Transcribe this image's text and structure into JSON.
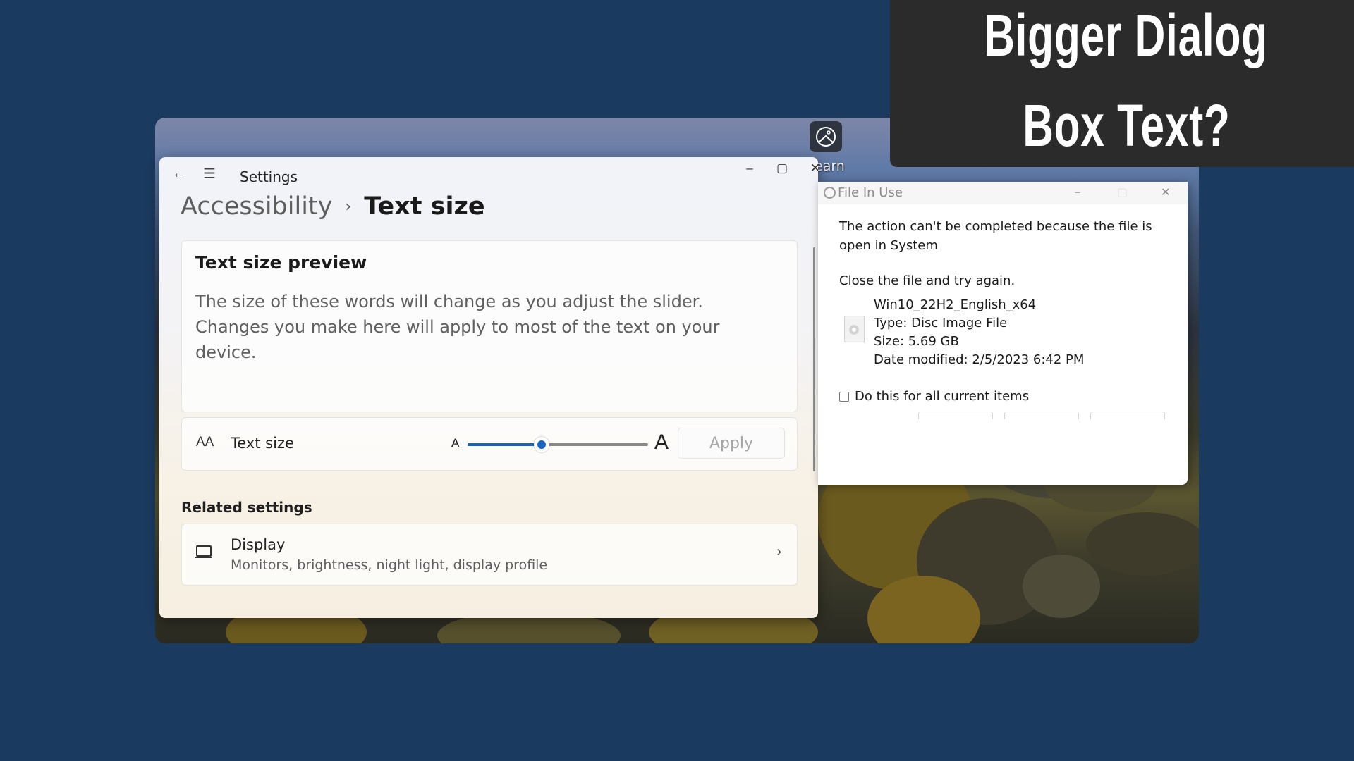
{
  "headline": {
    "line1": "Bigger Dialog",
    "line2": "Box Text?"
  },
  "desktop": {
    "learn_label": "earn"
  },
  "settings_window": {
    "app_title": "Settings",
    "controls": {
      "minimize": "–",
      "maximize": "▢",
      "close": "✕"
    },
    "back_icon": "←",
    "menu_icon": "☰",
    "breadcrumb": {
      "parent": "Accessibility",
      "separator": "›",
      "current": "Text size"
    },
    "preview": {
      "title": "Text size preview",
      "body": "The size of these words will change as you adjust the slider. Changes you make here will apply to most of the text on your device."
    },
    "text_size": {
      "icon": "AA",
      "label": "Text size",
      "small_a": "A",
      "large_a": "A",
      "slider_fraction": 0.41,
      "apply_label": "Apply",
      "apply_enabled": false
    },
    "related_settings": {
      "heading": "Related settings",
      "items": [
        {
          "title": "Display",
          "subtitle": "Monitors, brightness, night light, display profile",
          "chevron": "›"
        }
      ]
    },
    "accent_color": "#1565c0"
  },
  "file_in_use_dialog": {
    "title": "File In Use",
    "controls": {
      "minimize": "–",
      "maximize": "▢",
      "close": "✕"
    },
    "message": "The action can't be completed because the file is open in System",
    "instruction": "Close the file and try again.",
    "file": {
      "name": "Win10_22H2_English_x64",
      "type": "Type: Disc Image File",
      "size": "Size: 5.69 GB",
      "date_modified": "Date modified: 2/5/2023 6:42 PM"
    },
    "checkbox_label": "Do this for all current items",
    "checkbox_checked": false
  }
}
